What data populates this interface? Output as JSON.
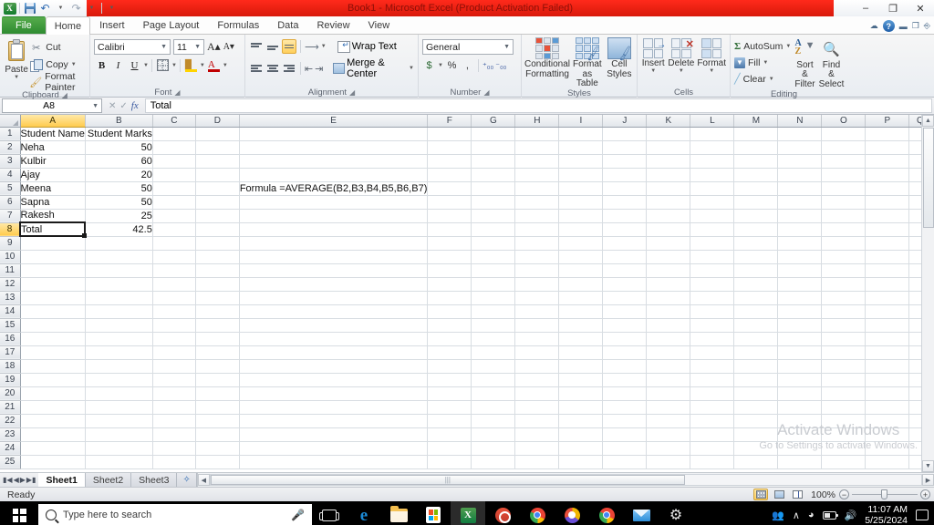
{
  "titlebar": {
    "app_title": "Book1  -  Microsoft Excel (Product Activation Failed)",
    "qat": [
      {
        "name": "excel-logo",
        "label": "X"
      },
      {
        "name": "save-icon",
        "label": "Save"
      },
      {
        "name": "undo-icon",
        "label": "Undo"
      },
      {
        "name": "redo-icon",
        "label": "Redo"
      },
      {
        "name": "customize-qat-icon",
        "label": "Customize Quick Access Toolbar"
      }
    ],
    "window_controls": {
      "minimize": "–",
      "restore": "❐",
      "close": "✕"
    }
  },
  "tabs": {
    "items": [
      {
        "label": "File",
        "active": false,
        "file": true
      },
      {
        "label": "Home",
        "active": true
      },
      {
        "label": "Insert",
        "active": false
      },
      {
        "label": "Page Layout",
        "active": false
      },
      {
        "label": "Formulas",
        "active": false
      },
      {
        "label": "Data",
        "active": false
      },
      {
        "label": "Review",
        "active": false
      },
      {
        "label": "View",
        "active": false
      }
    ],
    "help_controls": {
      "cloud": "☁",
      "help": "?",
      "minimize_ribbon": "—",
      "restore_window": "❐",
      "close_window": "⌧"
    }
  },
  "ribbon": {
    "clipboard": {
      "group_label": "Clipboard",
      "paste": "Paste",
      "cut": "Cut",
      "copy": "Copy",
      "format_painter": "Format Painter"
    },
    "font": {
      "group_label": "Font",
      "font_name": "Calibri",
      "font_size": "11",
      "grow_font": "A",
      "shrink_font": "A",
      "bold": "B",
      "italic": "I",
      "underline": "U",
      "borders": "Borders",
      "fill_color": "Fill Color",
      "font_color": "A"
    },
    "alignment": {
      "group_label": "Alignment",
      "top_align": "Top Align",
      "middle_align": "Middle Align",
      "bottom_align": "Bottom Align",
      "orientation": "Orientation",
      "wrap_text": "Wrap Text",
      "align_left": "Align Text Left",
      "align_center": "Center",
      "align_right": "Align Text Right",
      "decrease_indent": "Decrease Indent",
      "increase_indent": "Increase Indent",
      "merge_center": "Merge & Center"
    },
    "number": {
      "group_label": "Number",
      "format": "General",
      "accounting": "$",
      "percent": "%",
      "comma": ",",
      "increase_decimal": "Increase Decimal",
      "decrease_decimal": "Decrease Decimal"
    },
    "styles": {
      "group_label": "Styles",
      "conditional_formatting": "Conditional\nFormatting",
      "conditional_formatting_l1": "Conditional",
      "conditional_formatting_l2": "Formatting",
      "format_as_table_l1": "Format",
      "format_as_table_l2": "as Table",
      "cell_styles_l1": "Cell",
      "cell_styles_l2": "Styles"
    },
    "cells": {
      "group_label": "Cells",
      "insert": "Insert",
      "delete": "Delete",
      "format": "Format"
    },
    "editing": {
      "group_label": "Editing",
      "autosum": "AutoSum",
      "fill": "Fill",
      "clear": "Clear",
      "sort_filter_l1": "Sort &",
      "sort_filter_l2": "Filter",
      "find_select_l1": "Find &",
      "find_select_l2": "Select"
    }
  },
  "formula_bar": {
    "name_box": "A8",
    "cancel": "✕",
    "enter": "✓",
    "insert_function": "fx",
    "formula_value": "Total"
  },
  "grid": {
    "columns": [
      "A",
      "B",
      "C",
      "D",
      "E",
      "F",
      "G",
      "H",
      "I",
      "J",
      "K",
      "L",
      "M",
      "N",
      "O",
      "P",
      "Q"
    ],
    "selected_column": "A",
    "selected_row": 8,
    "row_count": 25,
    "cells": {
      "A1": "Student Name",
      "B1": "Student Marks",
      "A2": "Neha",
      "B2": "50",
      "A3": "Kulbir",
      "B3": "60",
      "A4": "Ajay",
      "B4": "20",
      "A5": "Meena",
      "B5": "50",
      "A6": "Sapna",
      "B6": "50",
      "A7": "Rakesh",
      "B7": "25",
      "A8": "Total",
      "B8": "42.5",
      "E5": "Formula =AVERAGE(B2,B3,B4,B5,B6,B7)"
    },
    "watermark": {
      "line1": "Activate Windows",
      "line2": "Go to Settings to activate Windows."
    }
  },
  "sheet_tabs": {
    "first": "⏮",
    "prev": "◀",
    "next": "▶",
    "last": "⏭",
    "sheets": [
      {
        "label": "Sheet1",
        "active": true
      },
      {
        "label": "Sheet2",
        "active": false
      },
      {
        "label": "Sheet3",
        "active": false
      }
    ],
    "insert_sheet": "➕"
  },
  "status_bar": {
    "status": "Ready",
    "view_normal": "Normal",
    "view_page_layout": "Page Layout",
    "view_page_break": "Page Break Preview",
    "zoom_level": "100%",
    "zoom_out": "−",
    "zoom_in": "+"
  },
  "taskbar": {
    "search_placeholder": "Type here to search",
    "apps": [
      {
        "name": "task-view-icon",
        "label": "Task View"
      },
      {
        "name": "edge-icon",
        "label": "Microsoft Edge"
      },
      {
        "name": "file-explorer-icon",
        "label": "File Explorer"
      },
      {
        "name": "microsoft-store-icon",
        "label": "Microsoft Store"
      },
      {
        "name": "excel-icon",
        "label": "Microsoft Excel"
      },
      {
        "name": "wps-office-icon",
        "label": "WPS Office"
      },
      {
        "name": "chrome-icon",
        "label": "Google Chrome"
      },
      {
        "name": "browser-icon",
        "label": "Browser"
      },
      {
        "name": "chrome-icon-2",
        "label": "Google Chrome"
      },
      {
        "name": "mail-icon",
        "label": "Mail"
      },
      {
        "name": "settings-icon",
        "label": "Settings"
      }
    ],
    "tray": {
      "people": "People",
      "show_hidden": "∧",
      "network": "Network",
      "battery": "Battery",
      "volume": "Volume"
    },
    "clock_time": "11:07 AM",
    "clock_date": "5/25/2024",
    "action_center": "Action Center"
  },
  "colors": {
    "title_red": "#e01a0c",
    "title_text": "#8d0f07",
    "file_tab_green": "#2e8b30",
    "selection_yellow": "#ffcb4d",
    "accent_blue": "#2f6bb3"
  }
}
